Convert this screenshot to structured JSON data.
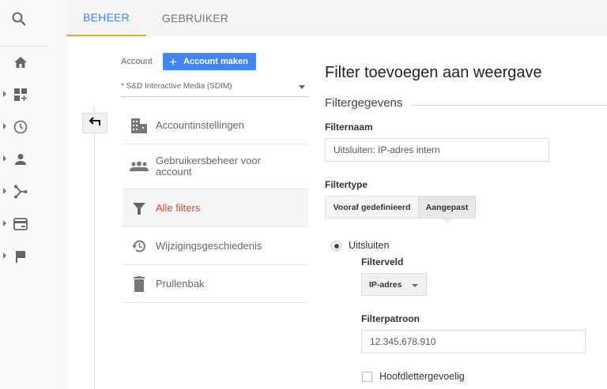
{
  "tabs": [
    {
      "label": "BEHEER",
      "active": true
    },
    {
      "label": "GEBRUIKER",
      "active": false
    }
  ],
  "sidebar": {
    "icons": [
      "search-icon",
      "home-icon",
      "dashboard-icon",
      "clock-icon",
      "person-icon",
      "share-icon",
      "window-icon",
      "flag-icon"
    ]
  },
  "account": {
    "label": "Account",
    "create_button": "Account maken",
    "selected": "* S&D Interactive Media (SDIM)"
  },
  "menu": [
    {
      "label": "Accountinstellingen",
      "icon": "building-icon"
    },
    {
      "label": "Gebruikersbeheer voor account",
      "icon": "people-icon"
    },
    {
      "label": "Alle filters",
      "icon": "filter-icon",
      "active": true
    },
    {
      "label": "Wijzigingsgeschiedenis",
      "icon": "history-icon"
    },
    {
      "label": "Prullenbak",
      "icon": "trash-icon"
    }
  ],
  "form": {
    "title": "Filter toevoegen aan weergave",
    "section": "Filtergegevens",
    "name_label": "Filternaam",
    "name_value": "Uitsluiten: IP-adres intern",
    "type_label": "Filtertype",
    "type_options": [
      "Vooraf gedefinieerd",
      "Aangepast"
    ],
    "type_selected": "Aangepast",
    "radio_label": "Uitsluiten",
    "field_label": "Filterveld",
    "field_value": "IP-adres",
    "pattern_label": "Filterpatroon",
    "pattern_value": "12.345.678.910",
    "case_label": "Hoofdlettergevoelig",
    "case_checked": false
  },
  "colors": {
    "accent": "#4285f4",
    "active": "#db4437",
    "tab_underline": "#f4a13a"
  }
}
